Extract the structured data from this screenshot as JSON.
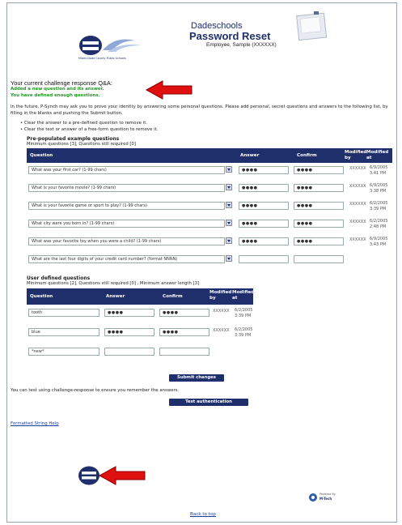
{
  "header": {
    "brand_title": "Dadeschools",
    "page_title": "Password Reset",
    "user_name": "Employee, Sample (XXXXXX)",
    "logo_caption": "Miami-Dade County Public Schools"
  },
  "status": {
    "heading": "Your current challenge response Q&A:",
    "message1": "Added a new question and its answer.",
    "message2": "You have defined enough questions."
  },
  "intro": {
    "text": "In the future, P-Synch may ask you to prove your identity by answering some personal questions. Please add personal, secret questions and answers to the following list, by filling in the blanks and pushing the Submit button.",
    "bullets": [
      "Clear the answer to a pre-defined question to remove it.",
      "Clear the text or answer of a free-form question to remove it."
    ]
  },
  "prepop": {
    "title": "Pre-populated example questions",
    "subtitle": "Minimum questions [3], Questions still required [0]",
    "columns": [
      "Question",
      "Answer",
      "Confirm",
      "Modified by",
      "Modified at"
    ],
    "rows": [
      {
        "question": "What was your first car? (1-99 chars)",
        "answer": "●●●●",
        "confirm": "●●●●",
        "by": "XXXXXX",
        "at": "6/9/2005 3:41 PM"
      },
      {
        "question": "What is your favorite movie? (1-99 chars)",
        "answer": "●●●●",
        "confirm": "●●●●",
        "by": "XXXXXX",
        "at": "6/9/2005 3:38 PM"
      },
      {
        "question": "What is your favorite game or sport to play? (1-99 chars)",
        "answer": "●●●●",
        "confirm": "●●●●",
        "by": "XXXXXX",
        "at": "6/2/2005 3:39 PM"
      },
      {
        "question": "What city were you born in? (1-99 chars)",
        "answer": "●●●●",
        "confirm": "●●●●",
        "by": "XXXXXX",
        "at": "6/2/2005 2:48 PM"
      },
      {
        "question": "What was your favorite toy when you were a child? (1-99 chars)",
        "answer": "●●●●",
        "confirm": "●●●●",
        "by": "XXXXXX",
        "at": "6/9/2005 3:43 PM"
      },
      {
        "question": "What are the last four digits of your credit card number? (format NNNN)",
        "answer": "",
        "confirm": "",
        "by": "",
        "at": ""
      }
    ]
  },
  "userdef": {
    "title": "User defined questions",
    "subtitle": "Minimum questions [2], Questions still required [0] , Minimum answer length [3]",
    "columns": [
      "Question",
      "Answer",
      "Confirm",
      "Modified by",
      "Modified at"
    ],
    "rows": [
      {
        "question": "tooth",
        "answer": "●●●●",
        "confirm": "●●●●",
        "by": "XXXXXX",
        "at": "6/2/2005 3:39 PM"
      },
      {
        "question": "blue",
        "answer": "●●●●",
        "confirm": "●●●●",
        "by": "XXXXXX",
        "at": "6/2/2005 3:39 PM"
      },
      {
        "question": "*new*",
        "answer": "",
        "confirm": "",
        "by": "",
        "at": ""
      }
    ]
  },
  "actions": {
    "submit_label": "Submit changes",
    "test_text": "You can test using challenge-response to ensure you remember the answers.",
    "test_label": "Test authentication",
    "help_link": "Formatted String Help",
    "back_link": "Back to top",
    "powered_by": "Powered By",
    "powered_brand": "M-Tech"
  },
  "colors": {
    "navy": "#1f2f6b",
    "green": "#1e9a1e",
    "arrow": "#e01010"
  }
}
